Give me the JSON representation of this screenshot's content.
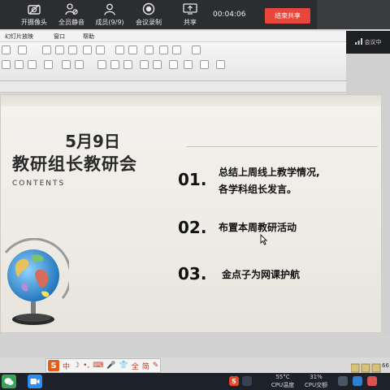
{
  "meeting_toolbar": {
    "items": [
      {
        "label": "开摄像头",
        "icon": "camera-off-icon"
      },
      {
        "label": "全员静音",
        "icon": "mute-all-icon"
      },
      {
        "label": "成员(9/9)",
        "icon": "members-icon"
      },
      {
        "label": "会议录制",
        "icon": "record-icon"
      },
      {
        "label": "共享",
        "icon": "share-screen-icon"
      }
    ],
    "timer": "00:04:06",
    "end_share_label": "结束共享"
  },
  "meeting_side": {
    "label": "会议中",
    "icon": "signal-bars-icon"
  },
  "ppt": {
    "menu": [
      "幻灯片放映",
      "窗口",
      "帮助"
    ]
  },
  "slide": {
    "date_title": "5月9日",
    "main_title": "教研组长教研会",
    "contents_label": "CONTENTS",
    "agenda": [
      {
        "num": "01.",
        "lines": [
          "总结上周线上教学情况,",
          "各学科组长发言。"
        ]
      },
      {
        "num": "02.",
        "lines": [
          "布置本周教研活动"
        ]
      },
      {
        "num": "03.",
        "lines": [
          "金点子为网课护航"
        ]
      }
    ]
  },
  "ime_bar": {
    "logo": "S",
    "lang": "中",
    "mode_full": "全",
    "mode_simplified": "简"
  },
  "taskbar": {
    "cpu_temp_value": "55°C",
    "cpu_temp_label": "CPU温度",
    "cpu_usage_value": "31%",
    "cpu_usage_label": "CPU交额",
    "edge_text": "66"
  }
}
